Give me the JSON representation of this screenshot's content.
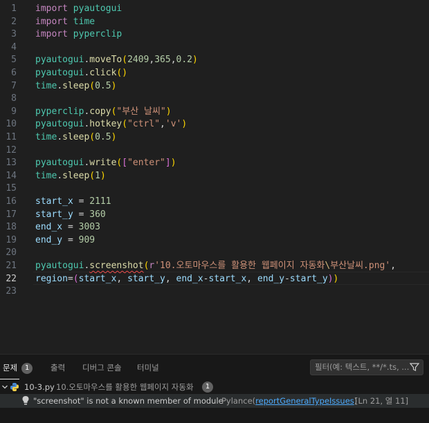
{
  "editor": {
    "active_line": "22",
    "lines": [
      {
        "n": "1",
        "tokens": [
          [
            "kw",
            "import"
          ],
          [
            "op",
            " "
          ],
          [
            "mod",
            "pyautogui"
          ]
        ]
      },
      {
        "n": "2",
        "tokens": [
          [
            "kw",
            "import"
          ],
          [
            "op",
            " "
          ],
          [
            "mod",
            "time"
          ]
        ]
      },
      {
        "n": "3",
        "tokens": [
          [
            "kw",
            "import"
          ],
          [
            "op",
            " "
          ],
          [
            "mod",
            "pyperclip"
          ]
        ]
      },
      {
        "n": "4",
        "tokens": []
      },
      {
        "n": "5",
        "tokens": [
          [
            "mod",
            "pyautogui"
          ],
          [
            "op",
            "."
          ],
          [
            "fn",
            "moveTo"
          ],
          [
            "p1",
            "("
          ],
          [
            "num",
            "2409"
          ],
          [
            "op",
            ","
          ],
          [
            "num",
            "365"
          ],
          [
            "op",
            ","
          ],
          [
            "num",
            "0.2"
          ],
          [
            "p1",
            ")"
          ]
        ]
      },
      {
        "n": "6",
        "tokens": [
          [
            "mod",
            "pyautogui"
          ],
          [
            "op",
            "."
          ],
          [
            "fn",
            "click"
          ],
          [
            "p1",
            "()"
          ]
        ]
      },
      {
        "n": "7",
        "tokens": [
          [
            "mod",
            "time"
          ],
          [
            "op",
            "."
          ],
          [
            "fn",
            "sleep"
          ],
          [
            "p1",
            "("
          ],
          [
            "num",
            "0.5"
          ],
          [
            "p1",
            ")"
          ]
        ]
      },
      {
        "n": "8",
        "tokens": []
      },
      {
        "n": "9",
        "tokens": [
          [
            "mod",
            "pyperclip"
          ],
          [
            "op",
            "."
          ],
          [
            "fn",
            "copy"
          ],
          [
            "p1",
            "("
          ],
          [
            "str",
            "\"부산 날씨\""
          ],
          [
            "p1",
            ")"
          ]
        ]
      },
      {
        "n": "10",
        "tokens": [
          [
            "mod",
            "pyautogui"
          ],
          [
            "op",
            "."
          ],
          [
            "fn",
            "hotkey"
          ],
          [
            "p1",
            "("
          ],
          [
            "str",
            "\"ctrl\""
          ],
          [
            "op",
            ","
          ],
          [
            "str",
            "'v'"
          ],
          [
            "p1",
            ")"
          ]
        ]
      },
      {
        "n": "11",
        "tokens": [
          [
            "mod",
            "time"
          ],
          [
            "op",
            "."
          ],
          [
            "fn",
            "sleep"
          ],
          [
            "p1",
            "("
          ],
          [
            "num",
            "0.5"
          ],
          [
            "p1",
            ")"
          ]
        ]
      },
      {
        "n": "12",
        "tokens": []
      },
      {
        "n": "13",
        "tokens": [
          [
            "mod",
            "pyautogui"
          ],
          [
            "op",
            "."
          ],
          [
            "fn",
            "write"
          ],
          [
            "p1",
            "("
          ],
          [
            "p2",
            "["
          ],
          [
            "str",
            "\"enter\""
          ],
          [
            "p2",
            "]"
          ],
          [
            "p1",
            ")"
          ]
        ]
      },
      {
        "n": "14",
        "tokens": [
          [
            "mod",
            "time"
          ],
          [
            "op",
            "."
          ],
          [
            "fn",
            "sleep"
          ],
          [
            "p1",
            "("
          ],
          [
            "num",
            "1"
          ],
          [
            "p1",
            ")"
          ]
        ]
      },
      {
        "n": "15",
        "tokens": []
      },
      {
        "n": "16",
        "tokens": [
          [
            "var",
            "start_x"
          ],
          [
            "op",
            " = "
          ],
          [
            "num",
            "2111"
          ]
        ]
      },
      {
        "n": "17",
        "tokens": [
          [
            "var",
            "start_y"
          ],
          [
            "op",
            " = "
          ],
          [
            "num",
            "360"
          ]
        ]
      },
      {
        "n": "18",
        "tokens": [
          [
            "var",
            "end_x"
          ],
          [
            "op",
            " = "
          ],
          [
            "num",
            "3003"
          ]
        ]
      },
      {
        "n": "19",
        "tokens": [
          [
            "var",
            "end_y"
          ],
          [
            "op",
            " = "
          ],
          [
            "num",
            "909"
          ]
        ]
      },
      {
        "n": "20",
        "tokens": []
      },
      {
        "n": "21",
        "tokens": [
          [
            "mod",
            "pyautogui"
          ],
          [
            "op",
            "."
          ],
          [
            "fn squiggle",
            "screenshot"
          ],
          [
            "p1",
            "("
          ],
          [
            "kw",
            "r"
          ],
          [
            "str",
            "'10.오토마우스를 활용한 웹페이지 자동화"
          ],
          [
            "esc",
            "\\"
          ],
          [
            "str",
            "부산날씨.png'"
          ],
          [
            "op",
            ","
          ]
        ]
      },
      {
        "n": "22",
        "tokens": [
          [
            "var",
            "region"
          ],
          [
            "op",
            "="
          ],
          [
            "p2",
            "("
          ],
          [
            "var",
            "start_x"
          ],
          [
            "op",
            ", "
          ],
          [
            "var",
            "start_y"
          ],
          [
            "op",
            ", "
          ],
          [
            "var",
            "end_x"
          ],
          [
            "op",
            "-"
          ],
          [
            "var",
            "start_x"
          ],
          [
            "op",
            ", "
          ],
          [
            "var",
            "end_y"
          ],
          [
            "op",
            "-"
          ],
          [
            "var",
            "start_y"
          ],
          [
            "p2",
            ")"
          ],
          [
            "p1",
            ")"
          ]
        ]
      },
      {
        "n": "23",
        "tokens": []
      }
    ]
  },
  "panel": {
    "tabs": [
      {
        "label": "문제",
        "badge": "1"
      },
      {
        "label": "출력"
      },
      {
        "label": "디버그 콘솔"
      },
      {
        "label": "터미널"
      }
    ],
    "filter_placeholder": "필터(예: 텍스트, **/*.ts, ...",
    "file_row": {
      "file_name": "10-3.py",
      "folder": "10.오토마우스를 활용한 웹페이지 자동화",
      "count": "1"
    },
    "problem_row": {
      "message": "\"screenshot\" is not a known member of module",
      "source": "Pylance",
      "rule_open": "(",
      "rule": "reportGeneralTypeIssues",
      "rule_close": ")",
      "location": "[Ln 21, 열 11]"
    }
  },
  "colors": {
    "editor_bg": "#1f1f1f",
    "keyword": "#c586c0",
    "module": "#4ec9b0",
    "function": "#dcdcaa",
    "string": "#ce9178",
    "number": "#b5cea8",
    "variable": "#9cdcfe",
    "error_squiggle": "#f14c4c",
    "link": "#4daafc"
  }
}
